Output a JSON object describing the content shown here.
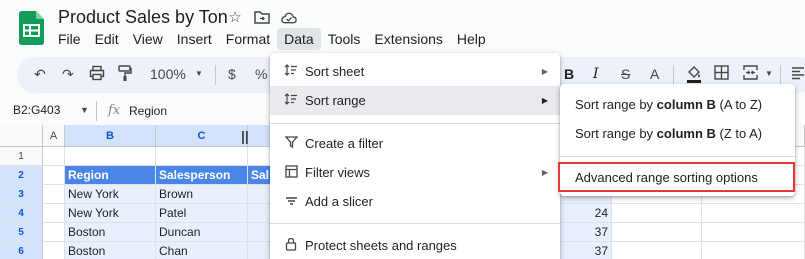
{
  "app": {
    "title": "Product Sales by Ton",
    "menu": [
      "File",
      "Edit",
      "View",
      "Insert",
      "Format",
      "Data",
      "Tools",
      "Extensions",
      "Help"
    ],
    "active_menu": "Data"
  },
  "toolbar": {
    "zoom": "100%",
    "currency": "$",
    "percent": "%",
    "bold": "B",
    "italic": "I",
    "strike": "S",
    "text_color": "A"
  },
  "formula_bar": {
    "name_box": "B2:G403",
    "fx": "fx",
    "value": "Region"
  },
  "grid": {
    "columns": [
      "A",
      "B",
      "C"
    ],
    "rows": [
      "1",
      "2",
      "3",
      "4",
      "5",
      "6"
    ],
    "table": [
      [
        "Region",
        "Salesperson",
        "Sal"
      ],
      [
        "New York",
        "Brown",
        ""
      ],
      [
        "New York",
        "Patel",
        ""
      ],
      [
        "Boston",
        "Duncan",
        ""
      ],
      [
        "Boston",
        "Chan",
        ""
      ]
    ],
    "right_values": [
      "24",
      "37",
      "37"
    ]
  },
  "data_menu": {
    "items": [
      {
        "label": "Sort sheet",
        "icon": "sort-icon",
        "submenu": true
      },
      {
        "label": "Sort range",
        "icon": "sort-icon",
        "submenu": true
      },
      {
        "label": "Create a filter",
        "icon": "filter-icon",
        "submenu": false
      },
      {
        "label": "Filter views",
        "icon": "filter-views-icon",
        "submenu": true
      },
      {
        "label": "Add a slicer",
        "icon": "slicer-icon",
        "submenu": false
      },
      {
        "label": "Protect sheets and ranges",
        "icon": "lock-icon",
        "submenu": false
      }
    ]
  },
  "sort_submenu": {
    "item1": {
      "prefix": "Sort range by ",
      "bold": "column B",
      "suffix": " (A to Z)"
    },
    "item2": {
      "prefix": "Sort range by ",
      "bold": "column B",
      "suffix": " (Z to A)"
    },
    "item3": "Advanced range sorting options"
  },
  "colors": {
    "header_fill": "#4a86e8",
    "selection_fill": "#e8f0fe",
    "highlight_outline": "#e53935",
    "sheets_green": "#0f9d58"
  }
}
